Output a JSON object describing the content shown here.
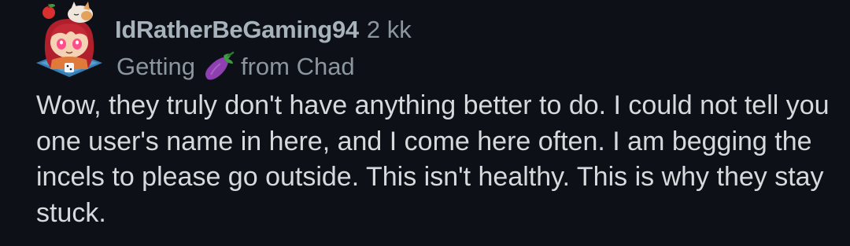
{
  "comment": {
    "author": "IdRatherBeGaming94",
    "age": "2 kk",
    "flair": {
      "before": "Getting",
      "icon": "eggplant-emoji-icon",
      "after": "from Chad"
    },
    "body": "Wow, they truly don't have anything better to do. I could not tell you one user's name in here, and I come here often. I am begging the incels to please go outside. This isn't healthy. This is why they stay stuck."
  },
  "colors": {
    "background": "#0d1117",
    "username": "#a8b2bb",
    "meta": "#8c969f",
    "body": "#d7dadc",
    "eggplant": "#8e3fb0"
  },
  "icons": {
    "avatar": "anime-girl-with-cat-avatar-icon"
  }
}
